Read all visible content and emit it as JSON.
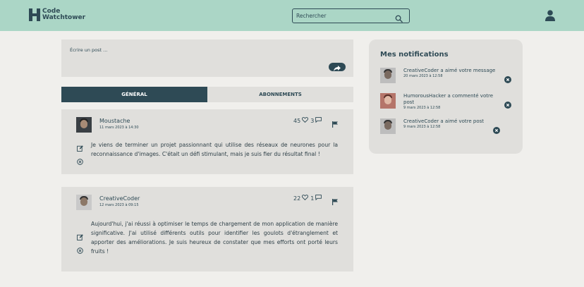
{
  "header": {
    "logo_line1": "Code",
    "logo_line2": "Watchtower",
    "search_placeholder": "Rechercher"
  },
  "composer": {
    "placeholder": "Écrire un post ..."
  },
  "tabs": [
    {
      "label": "GÉNÉRAL",
      "active": true
    },
    {
      "label": "ABONNEMENTS",
      "active": false
    }
  ],
  "posts": [
    {
      "author": "Moustache",
      "date": "11 mars 2023 à 14:30",
      "likes": "45",
      "comments": "3",
      "text": "Je viens de terminer un projet passionnant qui utilise des réseaux de neurones pour la reconnaissance d'images. C'était un défi stimulant, mais je suis fier du résultat final !"
    },
    {
      "author": "CreativeCoder",
      "date": "12 mars 2023 à 09:15",
      "likes": "22",
      "comments": "1",
      "text": "Aujourd'hui, j'ai réussi à optimiser le temps de chargement de mon application de manière significative. J'ai utilisé différents outils pour identifier les goulots d'étranglement et apporter des améliorations. Je suis heureux de constater que mes efforts ont porté leurs fruits !"
    }
  ],
  "notifications": {
    "title": "Mes notifications",
    "items": [
      {
        "message": "CreativeCoder a aimé votre message",
        "date": "20 mars 2023 à 12:58"
      },
      {
        "message": "HumorousHacker a commenté votre post",
        "date": "9 mars 2023 à 12:58"
      },
      {
        "message": "CreativeCoder a aimé votre post",
        "date": "9 mars 2023 à 12:58"
      }
    ]
  },
  "colors": {
    "header_bg": "#abd6c6",
    "primary": "#2e4a55",
    "card_bg": "#e0dfdc",
    "page_bg": "#f0efec"
  }
}
